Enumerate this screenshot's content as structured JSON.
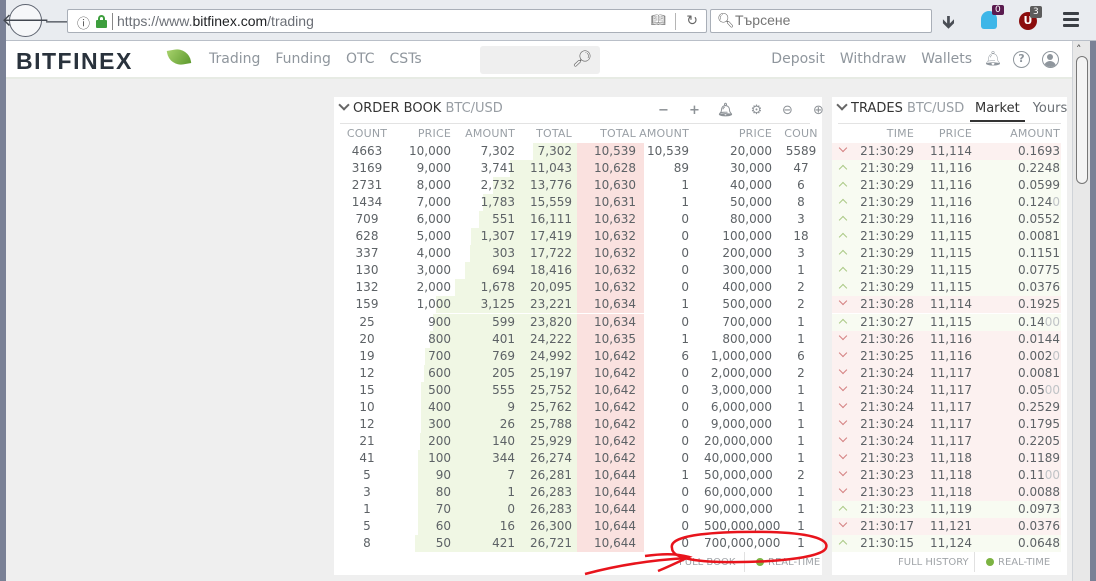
{
  "browser": {
    "url_prefix": "https://www.",
    "url_domain": "bitfinex.com",
    "url_path": "/trading",
    "search_placeholder": "Търсене",
    "ghost_badge": "0",
    "ublock_badge": "3",
    "ublock_letter": "U"
  },
  "site": {
    "logo": "BITFINEX",
    "nav": [
      "Trading",
      "Funding",
      "OTC",
      "CSTs"
    ],
    "right_nav": [
      "Deposit",
      "Withdraw",
      "Wallets"
    ]
  },
  "order_book": {
    "title": "ORDER BOOK",
    "pair": "BTC/USD",
    "tools": [
      "−",
      "+",
      "bell",
      "gear",
      "zoom-out",
      "zoom-in"
    ],
    "columns": [
      "COUNT",
      "PRICE",
      "AMOUNT",
      "TOTAL",
      "TOTAL",
      "AMOUNT",
      "PRICE",
      "COUN"
    ],
    "bids": [
      {
        "count": "4663",
        "price": "10,000",
        "amount": "7,302",
        "total": "7,302",
        "total_num": 7302
      },
      {
        "count": "3169",
        "price": "9,000",
        "amount": "3,741",
        "total": "11,043",
        "total_num": 11043
      },
      {
        "count": "2731",
        "price": "8,000",
        "amount": "2,732",
        "total": "13,776",
        "total_num": 13776
      },
      {
        "count": "1434",
        "price": "7,000",
        "amount": "1,783",
        "total": "15,559",
        "total_num": 15559
      },
      {
        "count": "709",
        "price": "6,000",
        "amount": "551",
        "total": "16,111",
        "total_num": 16111
      },
      {
        "count": "628",
        "price": "5,000",
        "amount": "1,307",
        "total": "17,419",
        "total_num": 17419
      },
      {
        "count": "337",
        "price": "4,000",
        "amount": "303",
        "total": "17,722",
        "total_num": 17722
      },
      {
        "count": "130",
        "price": "3,000",
        "amount": "694",
        "total": "18,416",
        "total_num": 18416
      },
      {
        "count": "132",
        "price": "2,000",
        "amount": "1,678",
        "total": "20,095",
        "total_num": 20095
      },
      {
        "count": "159",
        "price": "1,000",
        "amount": "3,125",
        "total": "23,221",
        "total_num": 23221
      },
      {
        "count": "25",
        "price": "900",
        "amount": "599",
        "total": "23,820",
        "total_num": 23820
      },
      {
        "count": "20",
        "price": "800",
        "amount": "401",
        "total": "24,222",
        "total_num": 24222
      },
      {
        "count": "19",
        "price": "700",
        "amount": "769",
        "total": "24,992",
        "total_num": 24992
      },
      {
        "count": "12",
        "price": "600",
        "amount": "205",
        "total": "25,197",
        "total_num": 25197
      },
      {
        "count": "15",
        "price": "500",
        "amount": "555",
        "total": "25,752",
        "total_num": 25752
      },
      {
        "count": "10",
        "price": "400",
        "amount": "9",
        "total": "25,762",
        "total_num": 25762
      },
      {
        "count": "12",
        "price": "300",
        "amount": "26",
        "total": "25,788",
        "total_num": 25788
      },
      {
        "count": "21",
        "price": "200",
        "amount": "140",
        "total": "25,929",
        "total_num": 25929
      },
      {
        "count": "41",
        "price": "100",
        "amount": "344",
        "total": "26,274",
        "total_num": 26274
      },
      {
        "count": "5",
        "price": "90",
        "amount": "7",
        "total": "26,281",
        "total_num": 26281
      },
      {
        "count": "3",
        "price": "80",
        "amount": "1",
        "total": "26,283",
        "total_num": 26283
      },
      {
        "count": "1",
        "price": "70",
        "amount": "0",
        "total": "26,283",
        "total_num": 26283
      },
      {
        "count": "5",
        "price": "60",
        "amount": "16",
        "total": "26,300",
        "total_num": 26300
      },
      {
        "count": "8",
        "price": "50",
        "amount": "421",
        "total": "26,721",
        "total_num": 26721
      }
    ],
    "asks": [
      {
        "total": "10,539",
        "amount": "10,539",
        "price": "20,000",
        "count": "5589",
        "total_num": 10539
      },
      {
        "total": "10,628",
        "amount": "89",
        "price": "30,000",
        "count": "47",
        "total_num": 10628
      },
      {
        "total": "10,630",
        "amount": "1",
        "price": "40,000",
        "count": "6",
        "total_num": 10630
      },
      {
        "total": "10,631",
        "amount": "1",
        "price": "50,000",
        "count": "8",
        "total_num": 10631
      },
      {
        "total": "10,632",
        "amount": "0",
        "price": "80,000",
        "count": "3",
        "total_num": 10632
      },
      {
        "total": "10,632",
        "amount": "0",
        "price": "100,000",
        "count": "18",
        "total_num": 10632
      },
      {
        "total": "10,632",
        "amount": "0",
        "price": "200,000",
        "count": "3",
        "total_num": 10632
      },
      {
        "total": "10,632",
        "amount": "0",
        "price": "300,000",
        "count": "1",
        "total_num": 10632
      },
      {
        "total": "10,632",
        "amount": "0",
        "price": "400,000",
        "count": "2",
        "total_num": 10632
      },
      {
        "total": "10,634",
        "amount": "1",
        "price": "500,000",
        "count": "2",
        "total_num": 10634
      },
      {
        "total": "10,634",
        "amount": "0",
        "price": "700,000",
        "count": "1",
        "total_num": 10634
      },
      {
        "total": "10,635",
        "amount": "1",
        "price": "800,000",
        "count": "1",
        "total_num": 10635
      },
      {
        "total": "10,642",
        "amount": "6",
        "price": "1,000,000",
        "count": "6",
        "total_num": 10642
      },
      {
        "total": "10,642",
        "amount": "0",
        "price": "2,000,000",
        "count": "2",
        "total_num": 10642
      },
      {
        "total": "10,642",
        "amount": "0",
        "price": "3,000,000",
        "count": "1",
        "total_num": 10642
      },
      {
        "total": "10,642",
        "amount": "0",
        "price": "6,000,000",
        "count": "1",
        "total_num": 10642
      },
      {
        "total": "10,642",
        "amount": "0",
        "price": "9,000,000",
        "count": "1",
        "total_num": 10642
      },
      {
        "total": "10,642",
        "amount": "0",
        "price": "20,000,000",
        "count": "1",
        "total_num": 10642
      },
      {
        "total": "10,642",
        "amount": "0",
        "price": "40,000,000",
        "count": "1",
        "total_num": 10642
      },
      {
        "total": "10,644",
        "amount": "1",
        "price": "50,000,000",
        "count": "2",
        "total_num": 10644
      },
      {
        "total": "10,644",
        "amount": "0",
        "price": "60,000,000",
        "count": "1",
        "total_num": 10644
      },
      {
        "total": "10,644",
        "amount": "0",
        "price": "90,000,000",
        "count": "1",
        "total_num": 10644
      },
      {
        "total": "10,644",
        "amount": "0",
        "price": "500,000,000",
        "count": "1",
        "total_num": 10644
      },
      {
        "total": "10,644",
        "amount": "0",
        "price": "700,000,000",
        "count": "1",
        "total_num": 10644
      }
    ],
    "footer_full": "FULL BOOK",
    "footer_rt": "REAL-TIME"
  },
  "trades": {
    "title": "TRADES",
    "pair": "BTC/USD",
    "tabs": [
      "Market",
      "Yours"
    ],
    "columns": [
      "TIME",
      "PRICE",
      "AMOUNT"
    ],
    "rows": [
      {
        "side": "sell",
        "time": "21:30:29",
        "price": "11,114",
        "amount": "0.1693",
        "faded": ""
      },
      {
        "side": "buy",
        "time": "21:30:29",
        "price": "11,116",
        "amount": "0.2248",
        "faded": ""
      },
      {
        "side": "buy",
        "time": "21:30:29",
        "price": "11,116",
        "amount": "0.0599",
        "faded": ""
      },
      {
        "side": "buy",
        "time": "21:30:29",
        "price": "11,116",
        "amount": "0.124",
        "faded": "0"
      },
      {
        "side": "buy",
        "time": "21:30:29",
        "price": "11,116",
        "amount": "0.0552",
        "faded": ""
      },
      {
        "side": "buy",
        "time": "21:30:29",
        "price": "11,115",
        "amount": "0.0081",
        "faded": ""
      },
      {
        "side": "buy",
        "time": "21:30:29",
        "price": "11,115",
        "amount": "0.1151",
        "faded": ""
      },
      {
        "side": "buy",
        "time": "21:30:29",
        "price": "11,115",
        "amount": "0.0775",
        "faded": ""
      },
      {
        "side": "buy",
        "time": "21:30:29",
        "price": "11,115",
        "amount": "0.0376",
        "faded": ""
      },
      {
        "side": "sell",
        "time": "21:30:28",
        "price": "11,114",
        "amount": "0.1925",
        "faded": ""
      },
      {
        "side": "buy",
        "time": "21:30:27",
        "price": "11,115",
        "amount": "0.14",
        "faded": "00"
      },
      {
        "side": "sell",
        "time": "21:30:26",
        "price": "11,116",
        "amount": "0.0144",
        "faded": ""
      },
      {
        "side": "sell",
        "time": "21:30:25",
        "price": "11,116",
        "amount": "0.002",
        "faded": "0"
      },
      {
        "side": "sell",
        "time": "21:30:24",
        "price": "11,117",
        "amount": "0.0081",
        "faded": ""
      },
      {
        "side": "sell",
        "time": "21:30:24",
        "price": "11,117",
        "amount": "0.05",
        "faded": "00"
      },
      {
        "side": "sell",
        "time": "21:30:24",
        "price": "11,117",
        "amount": "0.2529",
        "faded": ""
      },
      {
        "side": "sell",
        "time": "21:30:24",
        "price": "11,117",
        "amount": "0.1795",
        "faded": ""
      },
      {
        "side": "sell",
        "time": "21:30:24",
        "price": "11,117",
        "amount": "0.2205",
        "faded": ""
      },
      {
        "side": "sell",
        "time": "21:30:23",
        "price": "11,118",
        "amount": "0.1189",
        "faded": ""
      },
      {
        "side": "sell",
        "time": "21:30:23",
        "price": "11,118",
        "amount": "0.11",
        "faded": "00"
      },
      {
        "side": "sell",
        "time": "21:30:23",
        "price": "11,118",
        "amount": "0.0088",
        "faded": ""
      },
      {
        "side": "buy",
        "time": "21:30:23",
        "price": "11,119",
        "amount": "0.0973",
        "faded": ""
      },
      {
        "side": "sell",
        "time": "21:30:17",
        "price": "11,121",
        "amount": "0.0376",
        "faded": ""
      },
      {
        "side": "buy",
        "time": "21:30:15",
        "price": "11,124",
        "amount": "0.0648",
        "faded": ""
      }
    ],
    "footer_full": "FULL HISTORY",
    "footer_rt": "REAL-TIME"
  },
  "colors": {
    "bid_bar": "#f0f7e4",
    "ask_bar": "#fae1df",
    "live_dot": "#7cb342",
    "annotation": "#e8141c"
  }
}
